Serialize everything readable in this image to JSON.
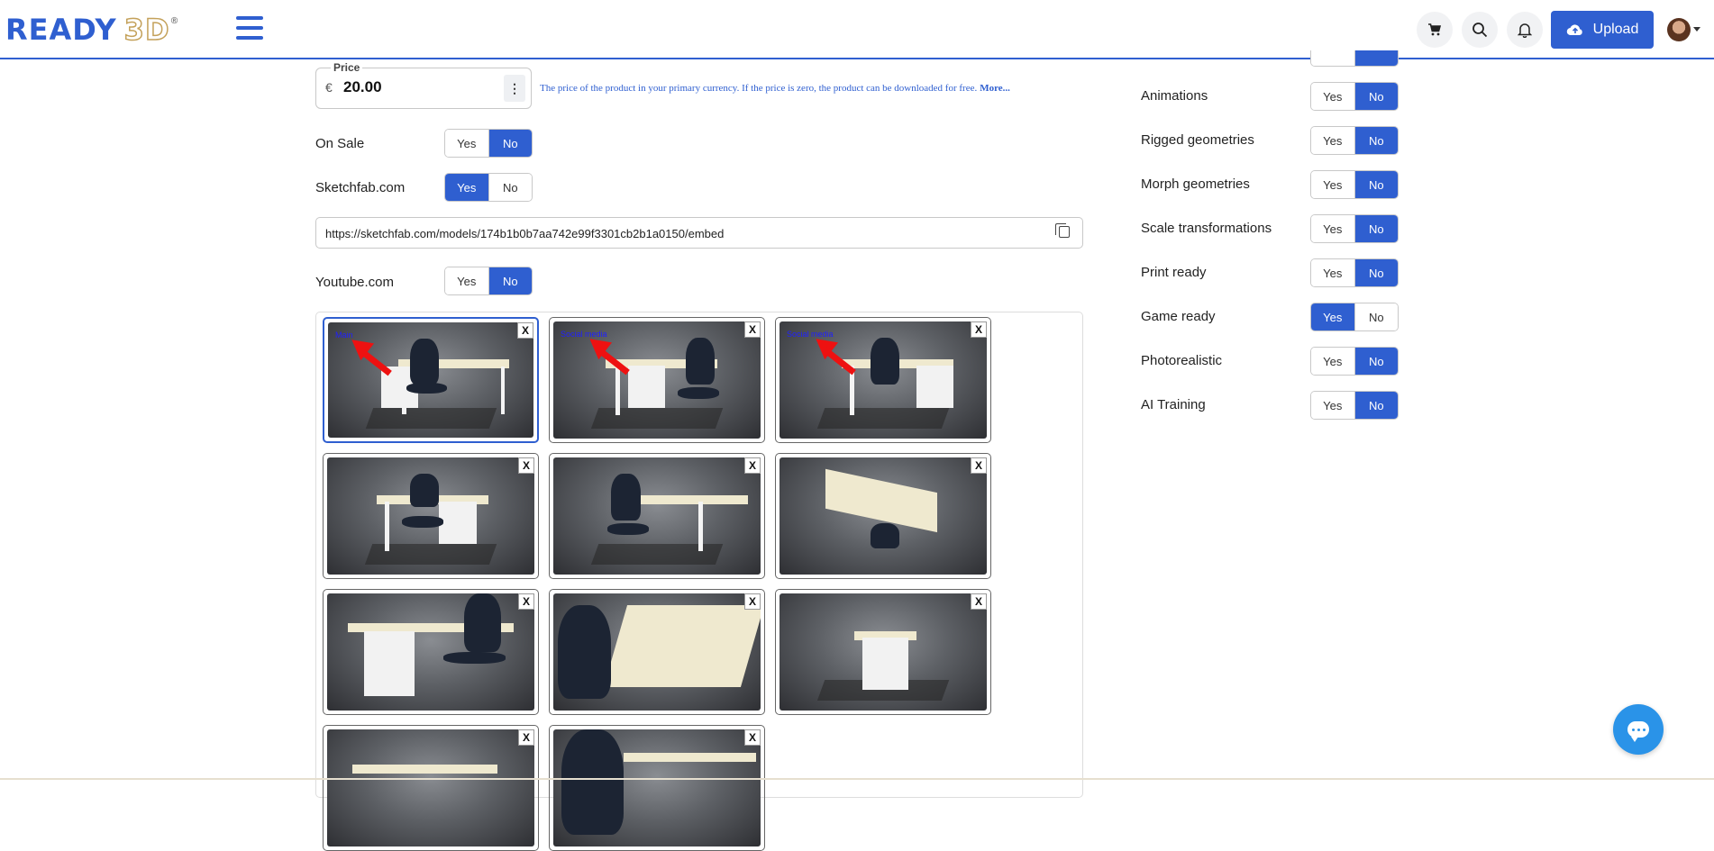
{
  "header": {
    "logo_text": "READY",
    "logo_3d": "3D",
    "logo_reg": "®",
    "upload_label": "Upload",
    "icons": [
      "cart-icon",
      "search-icon",
      "bell-icon",
      "cloud-upload-icon"
    ]
  },
  "price": {
    "legend": "Price",
    "currency": "€",
    "value": "20.00",
    "menu_glyph": "⋮",
    "help": "The price of the product in your primary currency. If the price is zero, the product can be downloaded for free.",
    "more": "More..."
  },
  "on_sale": {
    "label": "On Sale",
    "yes": "Yes",
    "no": "No",
    "selected": "No"
  },
  "sketchfab": {
    "label": "Sketchfab.com",
    "yes": "Yes",
    "no": "No",
    "selected": "Yes",
    "url": "https://sketchfab.com/models/174b1b0b7aa742e99f3301cb2b1a0150/embed"
  },
  "youtube": {
    "label": "Youtube.com",
    "yes": "Yes",
    "no": "No",
    "selected": "No"
  },
  "gallery": {
    "remove_glyph": "X",
    "tags": [
      "Main",
      "Social media",
      "Social media"
    ]
  },
  "options": [
    {
      "label": "Animations",
      "yes": "Yes",
      "no": "No",
      "selected": "No"
    },
    {
      "label": "Rigged geometries",
      "yes": "Yes",
      "no": "No",
      "selected": "No"
    },
    {
      "label": "Morph geometries",
      "yes": "Yes",
      "no": "No",
      "selected": "No"
    },
    {
      "label": "Scale transformations",
      "yes": "Yes",
      "no": "No",
      "selected": "No"
    },
    {
      "label": "Print ready",
      "yes": "Yes",
      "no": "No",
      "selected": "No"
    },
    {
      "label": "Game ready",
      "yes": "Yes",
      "no": "No",
      "selected": "Yes"
    },
    {
      "label": "Photorealistic",
      "yes": "Yes",
      "no": "No",
      "selected": "No"
    },
    {
      "label": "AI Training",
      "yes": "Yes",
      "no": "No",
      "selected": "No"
    }
  ],
  "colors": {
    "accent": "#2f5fd0",
    "chat": "#2a93e8"
  }
}
